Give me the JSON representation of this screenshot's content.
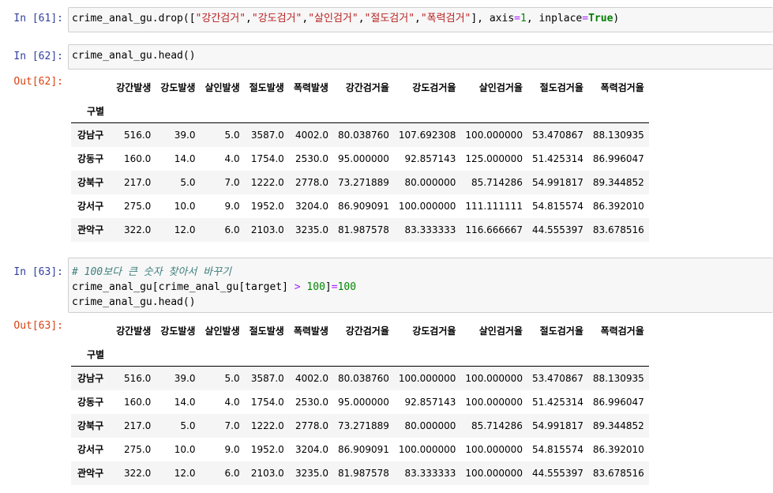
{
  "cells": [
    {
      "prompt": "In [61]:",
      "code_lines": [
        [
          {
            "t": "crime_anal_gu.drop([",
            "c": ""
          },
          {
            "t": "\"강간검거\"",
            "c": "s"
          },
          {
            "t": ",",
            "c": ""
          },
          {
            "t": "\"강도검거\"",
            "c": "s"
          },
          {
            "t": ",",
            "c": ""
          },
          {
            "t": "\"살인검거\"",
            "c": "s"
          },
          {
            "t": ",",
            "c": ""
          },
          {
            "t": "\"절도검거\"",
            "c": "s"
          },
          {
            "t": ",",
            "c": ""
          },
          {
            "t": "\"폭력검거\"",
            "c": "s"
          },
          {
            "t": "], axis",
            "c": ""
          },
          {
            "t": "=",
            "c": "op"
          },
          {
            "t": "1",
            "c": "n"
          },
          {
            "t": ", inplace",
            "c": ""
          },
          {
            "t": "=",
            "c": "op"
          },
          {
            "t": "True",
            "c": "kw"
          },
          {
            "t": ")",
            "c": ""
          }
        ]
      ]
    },
    {
      "prompt": "In [62]:",
      "code_lines": [
        [
          {
            "t": "crime_anal_gu.head()",
            "c": ""
          }
        ]
      ],
      "out_prompt": "Out[62]:",
      "table": {
        "columns": [
          "강간발생",
          "강도발생",
          "살인발생",
          "절도발생",
          "폭력발생",
          "강간검거율",
          "강도검거율",
          "살인검거율",
          "절도검거율",
          "폭력검거율"
        ],
        "index_name": "구별",
        "rows": [
          {
            "index": "강남구",
            "values": [
              "516.0",
              "39.0",
              "5.0",
              "3587.0",
              "4002.0",
              "80.038760",
              "107.692308",
              "100.000000",
              "53.470867",
              "88.130935"
            ]
          },
          {
            "index": "강동구",
            "values": [
              "160.0",
              "14.0",
              "4.0",
              "1754.0",
              "2530.0",
              "95.000000",
              "92.857143",
              "125.000000",
              "51.425314",
              "86.996047"
            ]
          },
          {
            "index": "강북구",
            "values": [
              "217.0",
              "5.0",
              "7.0",
              "1222.0",
              "2778.0",
              "73.271889",
              "80.000000",
              "85.714286",
              "54.991817",
              "89.344852"
            ]
          },
          {
            "index": "강서구",
            "values": [
              "275.0",
              "10.0",
              "9.0",
              "1952.0",
              "3204.0",
              "86.909091",
              "100.000000",
              "111.111111",
              "54.815574",
              "86.392010"
            ]
          },
          {
            "index": "관악구",
            "values": [
              "322.0",
              "12.0",
              "6.0",
              "2103.0",
              "3235.0",
              "81.987578",
              "83.333333",
              "116.666667",
              "44.555397",
              "83.678516"
            ]
          }
        ]
      }
    },
    {
      "prompt": "In [63]:",
      "code_lines": [
        [
          {
            "t": "# 100보다 큰 숫자 찾아서 바꾸기",
            "c": "cm"
          }
        ],
        [
          {
            "t": "crime_anal_gu[crime_anal_gu[target] ",
            "c": ""
          },
          {
            "t": ">",
            "c": "op"
          },
          {
            "t": " ",
            "c": ""
          },
          {
            "t": "100",
            "c": "n"
          },
          {
            "t": "]",
            "c": ""
          },
          {
            "t": "=",
            "c": "op"
          },
          {
            "t": "100",
            "c": "n"
          }
        ],
        [
          {
            "t": "crime_anal_gu.head()",
            "c": ""
          }
        ]
      ],
      "out_prompt": "Out[63]:",
      "table": {
        "columns": [
          "강간발생",
          "강도발생",
          "살인발생",
          "절도발생",
          "폭력발생",
          "강간검거율",
          "강도검거율",
          "살인검거율",
          "절도검거율",
          "폭력검거율"
        ],
        "index_name": "구별",
        "rows": [
          {
            "index": "강남구",
            "values": [
              "516.0",
              "39.0",
              "5.0",
              "3587.0",
              "4002.0",
              "80.038760",
              "100.000000",
              "100.000000",
              "53.470867",
              "88.130935"
            ]
          },
          {
            "index": "강동구",
            "values": [
              "160.0",
              "14.0",
              "4.0",
              "1754.0",
              "2530.0",
              "95.000000",
              "92.857143",
              "100.000000",
              "51.425314",
              "86.996047"
            ]
          },
          {
            "index": "강북구",
            "values": [
              "217.0",
              "5.0",
              "7.0",
              "1222.0",
              "2778.0",
              "73.271889",
              "80.000000",
              "85.714286",
              "54.991817",
              "89.344852"
            ]
          },
          {
            "index": "강서구",
            "values": [
              "275.0",
              "10.0",
              "9.0",
              "1952.0",
              "3204.0",
              "86.909091",
              "100.000000",
              "100.000000",
              "54.815574",
              "86.392010"
            ]
          },
          {
            "index": "관악구",
            "values": [
              "322.0",
              "12.0",
              "6.0",
              "2103.0",
              "3235.0",
              "81.987578",
              "83.333333",
              "100.000000",
              "44.555397",
              "83.678516"
            ]
          }
        ]
      }
    }
  ]
}
